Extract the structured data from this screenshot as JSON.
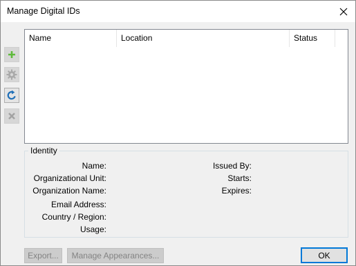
{
  "window": {
    "title": "Manage Digital IDs"
  },
  "toolbar": [
    {
      "name": "add-id",
      "icon": "plus-icon",
      "enabled": false
    },
    {
      "name": "settings",
      "icon": "gear-icon",
      "enabled": false
    },
    {
      "name": "refresh",
      "icon": "refresh-icon",
      "enabled": true
    },
    {
      "name": "remove-id",
      "icon": "x-icon",
      "enabled": false
    }
  ],
  "list": {
    "columns": [
      "Name",
      "Location",
      "Status"
    ],
    "rows": []
  },
  "identity": {
    "legend": "Identity",
    "left_fields": [
      "Name:",
      "Organizational Unit:",
      "Organization Name:",
      "Email Address:",
      "Country / Region:",
      "Usage:"
    ],
    "right_fields": [
      "Issued By:",
      "Starts:",
      "Expires:"
    ]
  },
  "buttons": {
    "export": "Export...",
    "manage_appearances": "Manage Appearances...",
    "ok": "OK"
  },
  "colors": {
    "accent": "#0078d7",
    "plus": "#5fba3c",
    "refresh": "#1f6fb8"
  }
}
